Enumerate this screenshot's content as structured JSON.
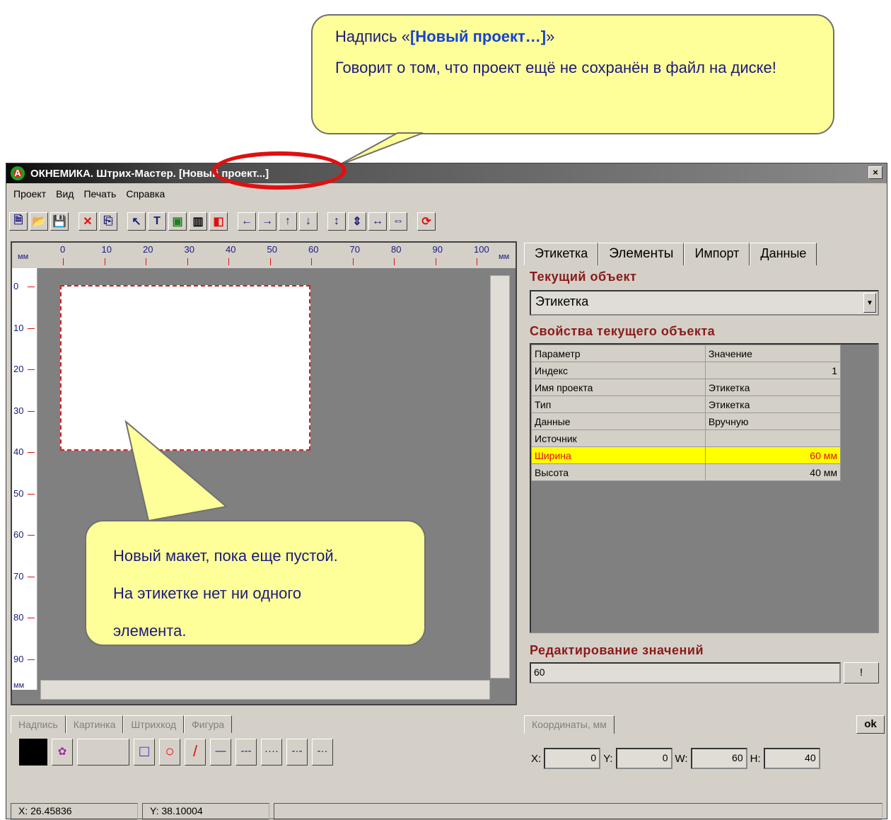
{
  "callout_top": {
    "line1_prefix": "Надпись «",
    "line1_bold": "[Новый проект…]",
    "line1_suffix": "»",
    "line2": "Говорит о том, что проект ещё не сохранён в файл на диске!"
  },
  "window": {
    "title": "ОКНЕМИКА. Штрих-Мастер. [Новый проект...]",
    "close": "×"
  },
  "menu": [
    "Проект",
    "Вид",
    "Печать",
    "Справка"
  ],
  "toolbar": [
    {
      "name": "new-icon",
      "g": "🗎",
      "c": "#1a1a80"
    },
    {
      "name": "open-icon",
      "g": "📂",
      "c": "#b08000"
    },
    {
      "name": "save-icon",
      "g": "💾",
      "c": "#1a1a80"
    },
    {
      "sep": true
    },
    {
      "name": "delete-icon",
      "g": "✕",
      "c": "#e01010"
    },
    {
      "name": "copy-icon",
      "g": "⎘",
      "c": "#1a1a80"
    },
    {
      "sep": true
    },
    {
      "name": "select-icon",
      "g": "↖",
      "c": "#1a1a80"
    },
    {
      "name": "text-icon",
      "g": "T",
      "c": "#1a1a80"
    },
    {
      "name": "image-icon",
      "g": "▣",
      "c": "#208020"
    },
    {
      "name": "barcode-icon",
      "g": "▥",
      "c": "#000"
    },
    {
      "name": "shape-icon",
      "g": "◧",
      "c": "#e01010"
    },
    {
      "sep": true
    },
    {
      "name": "arrow-left-icon",
      "g": "←",
      "c": "#1a1a80"
    },
    {
      "name": "arrow-right-icon",
      "g": "→",
      "c": "#1a1a80"
    },
    {
      "name": "arrow-up-icon",
      "g": "↑",
      "c": "#1a1a80"
    },
    {
      "name": "arrow-down-icon",
      "g": "↓",
      "c": "#1a1a80"
    },
    {
      "sep": true
    },
    {
      "name": "stretch-v-icon",
      "g": "↕",
      "c": "#1a1a80"
    },
    {
      "name": "shrink-v-icon",
      "g": "⇕",
      "c": "#1a1a80"
    },
    {
      "name": "stretch-h-icon",
      "g": "↔",
      "c": "#1a1a80"
    },
    {
      "name": "shrink-h-icon",
      "g": "⇔",
      "c": "#1a1a80"
    },
    {
      "sep": true
    },
    {
      "name": "refresh-icon",
      "g": "⟳",
      "c": "#e01010"
    }
  ],
  "ruler": {
    "unit": "мм",
    "top_ticks": [
      "0",
      "10",
      "20",
      "30",
      "40",
      "50",
      "60",
      "70",
      "80",
      "90",
      "100"
    ],
    "left_ticks": [
      "0",
      "10",
      "20",
      "30",
      "40",
      "50",
      "60",
      "70",
      "80",
      "90"
    ]
  },
  "callout_low": {
    "line1": "Новый макет, пока еще пустой.",
    "line2": "На этикетке нет ни одного",
    "line3": "элемента."
  },
  "props": {
    "tabs": [
      "Этикетка",
      "Элементы",
      "Импорт",
      "Данные"
    ],
    "current_object_title": "Текущий объект",
    "current_object_value": "Этикетка",
    "properties_title": "Свойства текущего объекта",
    "columns": [
      "Параметр",
      "Значение"
    ],
    "rows": [
      [
        "Индекс",
        "1"
      ],
      [
        "Имя проекта",
        "Этикетка"
      ],
      [
        "Тип",
        "Этикетка"
      ],
      [
        "Данные",
        "Вручную"
      ],
      [
        "Источник",
        ""
      ],
      [
        "Ширина",
        "60 мм"
      ],
      [
        "Высота",
        "40 мм"
      ]
    ],
    "edit_title": "Редактирование значений",
    "edit_value": "60",
    "edit_button": "!"
  },
  "bottom_tabs": [
    "Надпись",
    "Картинка",
    "Штрихкод",
    "Фигура"
  ],
  "coords": {
    "tab": "Координаты, мм",
    "ok": "ok",
    "x_label": "X:",
    "x": "0",
    "y_label": "Y:",
    "y": "0",
    "w_label": "W:",
    "w": "60",
    "h_label": "H:",
    "h": "40"
  },
  "status": {
    "x_label": "X:",
    "x": "26.45836",
    "y_label": "Y:",
    "y": "38.10004"
  }
}
